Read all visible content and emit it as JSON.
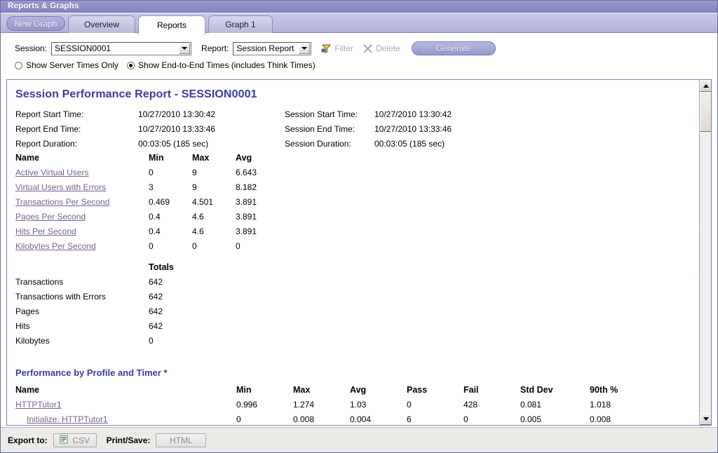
{
  "window": {
    "title": "Reports & Graphs"
  },
  "tabs": {
    "new_graph": "New Graph",
    "items": [
      {
        "label": "Overview",
        "active": false
      },
      {
        "label": "Reports",
        "active": true
      },
      {
        "label": "Graph 1",
        "active": false
      }
    ]
  },
  "toolbar": {
    "session_label": "Session:",
    "session_value": "SESSION0001",
    "report_label": "Report:",
    "report_value": "Session Report",
    "filter_label": "Filter",
    "delete_label": "Delete",
    "generate_label": "Generate",
    "radio_server_label": "Show Server Times Only",
    "radio_endtoend_label": "Show End-to-End Times (includes Think Times)",
    "radio_selected": "end_to_end"
  },
  "report": {
    "title": "Session Performance Report - SESSION0001",
    "meta_left": [
      {
        "key": "Report Start Time:",
        "value": "10/27/2010 13:30:42"
      },
      {
        "key": "Report End Time:",
        "value": "10/27/2010 13:33:46"
      },
      {
        "key": "Report Duration:",
        "value": "00:03:05 (185 sec)"
      }
    ],
    "meta_right": [
      {
        "key": "Session Start Time:",
        "value": "10/27/2010 13:30:42"
      },
      {
        "key": "Session End Time:",
        "value": "10/27/2010 13:33:46"
      },
      {
        "key": "Session Duration:",
        "value": "00:03:05 (185 sec)"
      }
    ],
    "summary_headers": [
      "Name",
      "Min",
      "Max",
      "Avg"
    ],
    "summary_rows": [
      {
        "name": "Active Virtual Users",
        "min": "0",
        "max": "9",
        "avg": "6.643"
      },
      {
        "name": "Virtual Users with Errors",
        "min": "3",
        "max": "9",
        "avg": "8.182"
      },
      {
        "name": "Transactions Per Second",
        "min": "0.469",
        "max": "4.501",
        "avg": "3.891"
      },
      {
        "name": "Pages Per Second",
        "min": "0.4",
        "max": "4.6",
        "avg": "3.891"
      },
      {
        "name": "Hits Per Second",
        "min": "0.4",
        "max": "4.6",
        "avg": "3.891"
      },
      {
        "name": "Kilobytes Per Second",
        "min": "0",
        "max": "0",
        "avg": "0"
      }
    ],
    "totals_header": "Totals",
    "totals_rows": [
      {
        "name": "Transactions",
        "total": "642"
      },
      {
        "name": "Transactions with Errors",
        "total": "642"
      },
      {
        "name": "Pages",
        "total": "642"
      },
      {
        "name": "Hits",
        "total": "642"
      },
      {
        "name": "Kilobytes",
        "total": "0"
      }
    ],
    "perf_section_title": "Performance by Profile and Timer *",
    "perf_headers": [
      "Name",
      "Min",
      "Max",
      "Avg",
      "Pass",
      "Fail",
      "Std Dev",
      "90th %"
    ],
    "perf_rows": [
      {
        "name": "HTTPTutor1",
        "indent": false,
        "min": "0.996",
        "max": "1.274",
        "avg": "1.03",
        "pass": "0",
        "fail": "428",
        "stddev": "0.081",
        "p90": "1.018"
      },
      {
        "name": "Initialize: HTTPTutor1",
        "indent": true,
        "min": "0",
        "max": "0.008",
        "avg": "0.004",
        "pass": "6",
        "fail": "0",
        "stddev": "0.005",
        "p90": "0.008"
      }
    ]
  },
  "footer": {
    "export_label": "Export to:",
    "csv_label": "CSV",
    "print_label": "Print/Save:",
    "html_label": "HTML"
  },
  "colors": {
    "titlebar": "#8f8fc8",
    "accent_heading": "#3b3b9e",
    "link": "#7a5f8e",
    "tab_active_bg": "#ffffff"
  }
}
